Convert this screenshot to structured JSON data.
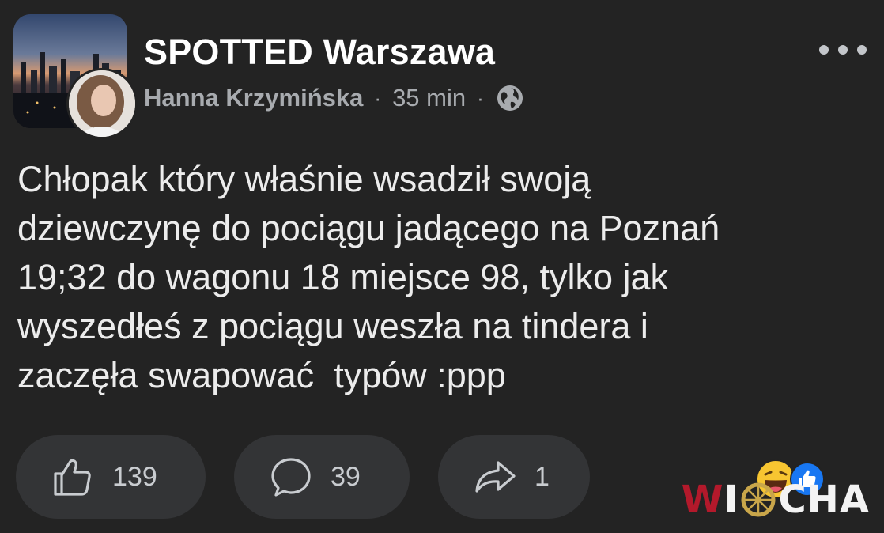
{
  "post": {
    "group_name": "SPOTTED Warszawa",
    "author": "Hanna Krzymińska",
    "separator": "·",
    "time": "35 min",
    "visibility_icon": "globe-icon",
    "more_icon": "more-options-icon",
    "text": "Chłopak który właśnie wsadził swoją\ndziewczynę do pociągu jadącego na Poznań\n19;32 do wagonu 18 miejsce 98, tylko jak\nwyszedłeś z pociągu weszła na tindera i\nzaczęła swapować  typów :ppp"
  },
  "actions": {
    "like": {
      "icon": "thumbs-up-icon",
      "count": "139"
    },
    "comment": {
      "icon": "comment-bubble-icon",
      "count": "39"
    },
    "share": {
      "icon": "share-arrow-icon",
      "count": "1"
    }
  },
  "reactions": [
    "haha-reaction",
    "like-reaction"
  ],
  "watermark": {
    "part1": "W",
    "part2": "I",
    "wheel_icon": "wheel-icon",
    "part3": "CHA"
  },
  "colors": {
    "background": "#232323",
    "pill": "#333436",
    "secondary_text": "#a8abaf",
    "like_blue": "#1877f2",
    "watermark_red": "#b3192b"
  }
}
